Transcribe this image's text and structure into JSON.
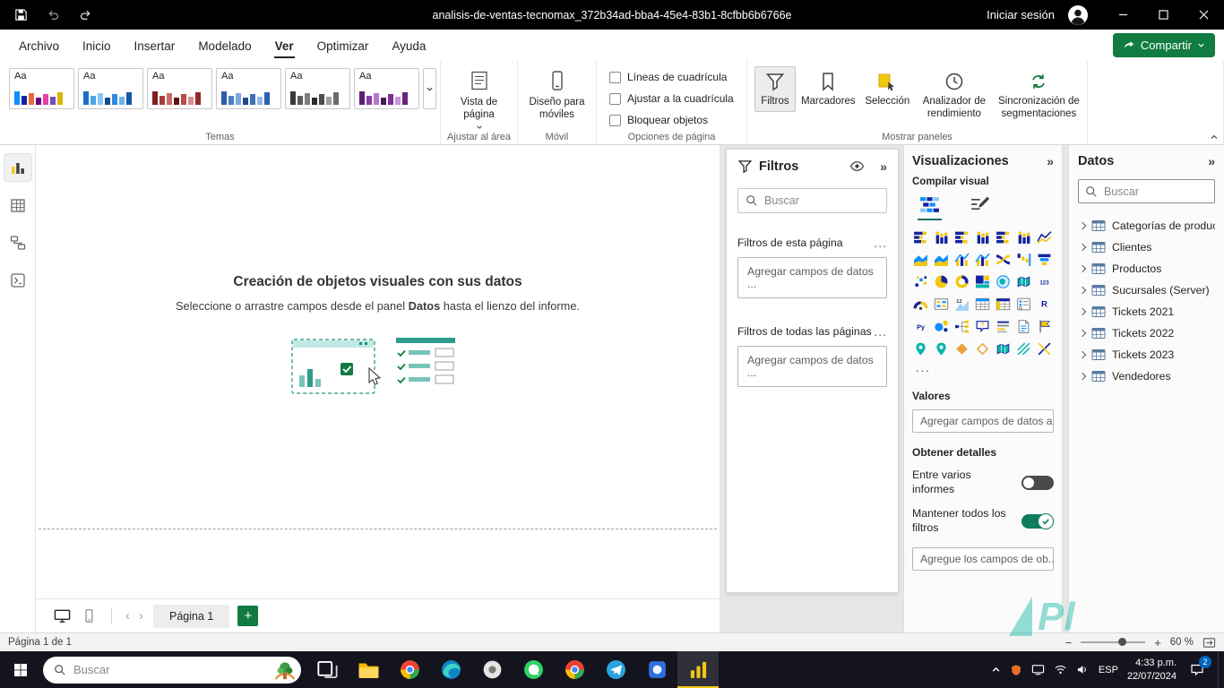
{
  "titlebar": {
    "title": "analisis-de-ventas-tecnomax_372b34ad-bba4-45e4-83b1-8cfbb6b6766e",
    "signin": "Iniciar sesión"
  },
  "menubar": {
    "items": [
      "Archivo",
      "Inicio",
      "Insertar",
      "Modelado",
      "Ver",
      "Optimizar",
      "Ayuda"
    ],
    "active_item": "Ver",
    "share_label": "Compartir"
  },
  "ribbon": {
    "aa_label": "Aa",
    "themes": [
      {
        "name": "predeterminado",
        "colors": [
          "#118DFF",
          "#12239E",
          "#E66C37",
          "#6B007B",
          "#E044A7",
          "#744EC2",
          "#D9B300"
        ]
      },
      {
        "name": "azul",
        "colors": [
          "#1B6EC2",
          "#4DA3E8",
          "#8CC7F5",
          "#0F4C8B",
          "#2F8AD9",
          "#6FB3EE",
          "#1259A8"
        ]
      },
      {
        "name": "carmesi",
        "colors": [
          "#7E1F1F",
          "#A83C3C",
          "#C96A6A",
          "#5E1212",
          "#B54D4D",
          "#D98E8E",
          "#8F2B2B"
        ]
      },
      {
        "name": "clasico",
        "colors": [
          "#2C5EA9",
          "#4D7FC4",
          "#7FA8DC",
          "#1F4B8E",
          "#3D6FB8",
          "#91B8E8",
          "#2A62B0"
        ]
      },
      {
        "name": "gris",
        "colors": [
          "#3A3A3A",
          "#5C5C5C",
          "#7E7E7E",
          "#2B2B2B",
          "#4D4D4D",
          "#9E9E9E",
          "#6B6B6B"
        ]
      },
      {
        "name": "orquidea",
        "colors": [
          "#5B2071",
          "#8B3FA8",
          "#B678CC",
          "#471A5A",
          "#7A2F96",
          "#C998DB",
          "#662580"
        ]
      }
    ],
    "groups": {
      "themes": {
        "label": "Temas"
      },
      "fit": {
        "label": "Ajustar al área",
        "button_label": "Vista de página"
      },
      "mobile": {
        "label": "Móvil",
        "button_label": "Diseño para móviles"
      },
      "page_options": {
        "label": "Opciones de página",
        "checkboxes": [
          "Líneas de cuadrícula",
          "Ajustar a la cuadrícula",
          "Bloquear objetos"
        ]
      },
      "show_panes": {
        "label": "Mostrar paneles",
        "buttons": [
          "Filtros",
          "Marcadores",
          "Selección",
          "Analizador de rendimiento",
          "Sincronización de segmentaciones"
        ],
        "active_button": "Filtros"
      }
    }
  },
  "canvas": {
    "empty_title": "Creación de objetos visuales con sus datos",
    "empty_subtitle_prefix": "Seleccione o arrastre campos desde el panel ",
    "empty_subtitle_bold": "Datos",
    "empty_subtitle_suffix": " hasta el lienzo del informe."
  },
  "pagebar": {
    "page_tab": "Página 1"
  },
  "filters_panel": {
    "title": "Filtros",
    "search_placeholder": "Buscar",
    "section_page": {
      "label": "Filtros de esta página",
      "more": "...",
      "drop_hint": "Agregar campos de datos ..."
    },
    "section_all": {
      "label": "Filtros de todas las páginas",
      "more": "...",
      "drop_hint": "Agregar campos de datos ..."
    }
  },
  "visualizations_panel": {
    "title": "Visualizaciones",
    "build_label": "Compilar visual",
    "more_label": "...",
    "values_label": "Valores",
    "values_drop_hint": "Agregar campos de datos a...",
    "drill_label": "Obtener detalles",
    "cross_report_label": "Entre varios informes",
    "keep_filters_label": "Mantener todos los filtros",
    "drill_drop_hint": "Agregue los campos de ob...",
    "icons": [
      {
        "name": "stacked-bar-chart",
        "k": "barh"
      },
      {
        "name": "stacked-column-chart",
        "k": "barv"
      },
      {
        "name": "clustered-bar-chart",
        "k": "barh"
      },
      {
        "name": "clustered-column-chart",
        "k": "barv"
      },
      {
        "name": "stacked-bar-100",
        "k": "barh"
      },
      {
        "name": "stacked-column-100",
        "k": "barv"
      },
      {
        "name": "line-chart",
        "k": "line"
      },
      {
        "name": "area-chart",
        "k": "area"
      },
      {
        "name": "stacked-area-chart",
        "k": "area"
      },
      {
        "name": "line-stacked-column-chart",
        "k": "combo"
      },
      {
        "name": "line-clustered-column-chart",
        "k": "combo"
      },
      {
        "name": "ribbon-chart",
        "k": "ribbon"
      },
      {
        "name": "waterfall-chart",
        "k": "waterfall"
      },
      {
        "name": "funnel-chart",
        "k": "funnel"
      },
      {
        "name": "scatter-chart",
        "k": "scatter"
      },
      {
        "name": "pie-chart",
        "k": "pie"
      },
      {
        "name": "donut-chart",
        "k": "donut"
      },
      {
        "name": "treemap",
        "k": "treemap"
      },
      {
        "name": "map",
        "k": "map"
      },
      {
        "name": "filled-map",
        "k": "mapf"
      },
      {
        "name": "card",
        "k": "txt",
        "t": "123"
      },
      {
        "name": "gauge",
        "k": "gauge"
      },
      {
        "name": "multi-row-card",
        "k": "mcard"
      },
      {
        "name": "kpi",
        "k": "kpi"
      },
      {
        "name": "table",
        "k": "table"
      },
      {
        "name": "matrix",
        "k": "matrix"
      },
      {
        "name": "slicer",
        "k": "slicer"
      },
      {
        "name": "r-script-visual",
        "k": "txt",
        "t": "R"
      },
      {
        "name": "python-visual",
        "k": "txt",
        "t": "Py"
      },
      {
        "name": "key-influencers",
        "k": "influence"
      },
      {
        "name": "decomposition-tree",
        "k": "tree"
      },
      {
        "name": "qa-visual",
        "k": "qa"
      },
      {
        "name": "smart-narrative",
        "k": "narrative"
      },
      {
        "name": "paginated-report",
        "k": "page"
      },
      {
        "name": "metrics",
        "k": "flag"
      },
      {
        "name": "azure-map",
        "k": "pin"
      },
      {
        "name": "arcgis-map",
        "k": "pin"
      },
      {
        "name": "power-apps-visual",
        "k": "diamond"
      },
      {
        "name": "power-automate-visual",
        "k": "diamond2"
      },
      {
        "name": "shape-map",
        "k": "mapf"
      },
      {
        "name": "custom-visual-1",
        "k": "diag"
      },
      {
        "name": "custom-visual-2",
        "k": "diag2"
      }
    ]
  },
  "data_panel": {
    "title": "Datos",
    "search_placeholder": "Buscar",
    "tables": [
      "Categorías de product...",
      "Clientes",
      "Productos",
      "Sucursales (Server)",
      "Tickets 2021",
      "Tickets 2022",
      "Tickets 2023",
      "Vendedores"
    ]
  },
  "statusbar": {
    "page_status": "Página 1 de 1",
    "zoom_label": "60 %"
  },
  "taskbar": {
    "search_placeholder": "Buscar",
    "language": "ESP",
    "time": "4:33 p.m.",
    "date": "22/07/2024",
    "notification_count": "2",
    "apps": [
      {
        "name": "task-view"
      },
      {
        "name": "file-explorer"
      },
      {
        "name": "google-chrome"
      },
      {
        "name": "microsoft-edge"
      },
      {
        "name": "settings"
      },
      {
        "name": "whatsapp"
      },
      {
        "name": "chrome-profile"
      },
      {
        "name": "telegram"
      },
      {
        "name": "photos"
      },
      {
        "name": "power-bi",
        "active": true
      }
    ]
  },
  "watermark": "Pl",
  "accent_colors": {
    "share_green": "#107C41",
    "powerbi_yellow": "#F2C811",
    "toggle_on": "#0f7b5f"
  }
}
